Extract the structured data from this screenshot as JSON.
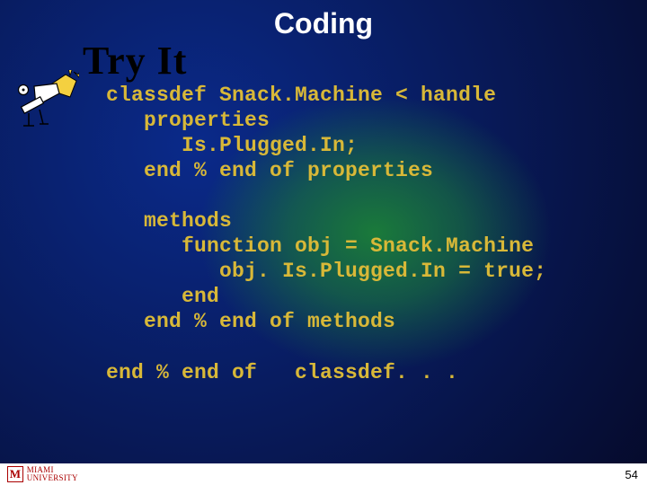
{
  "title": "Coding",
  "tryit": "Try It",
  "code": {
    "l1": "classdef Snack.Machine < handle",
    "l2": "   properties",
    "l3": "      Is.Plugged.In;",
    "l4": "   end % end of properties",
    "l5": "",
    "l6": "   methods",
    "l7": "      function obj = Snack.Machine",
    "l8": "         obj. Is.Plugged.In = true;",
    "l9": "      end",
    "l10": "   end % end of methods",
    "l11": "",
    "l12": "end % end of   classdef. . ."
  },
  "logo": {
    "m": "M",
    "text": "MIAMI UNIVERSITY"
  },
  "page": "54"
}
